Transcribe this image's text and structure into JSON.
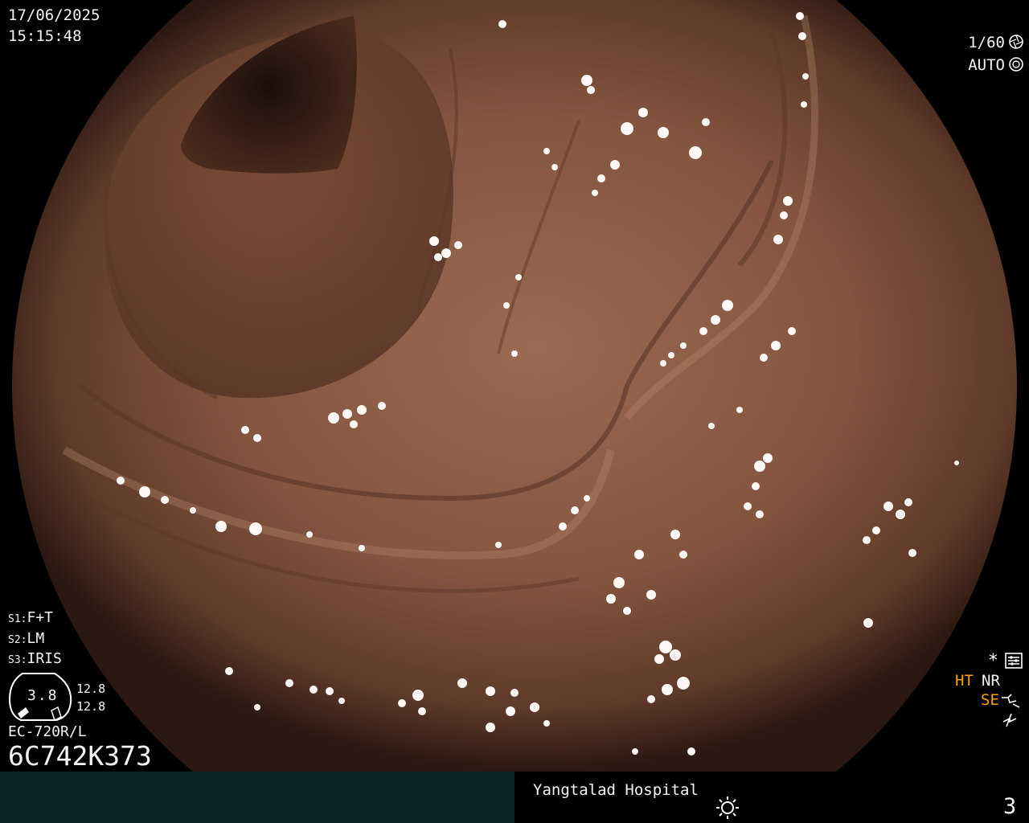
{
  "header": {
    "date": "17/06/2025",
    "time": "15:15:48",
    "shutter": "1/60",
    "exposure_mode": "AUTO"
  },
  "settings": {
    "s1_label": "S1:",
    "s1_value": "F+T",
    "s2_label": "S2:",
    "s2_value": "LM",
    "s3_label": "S3:",
    "s3_value": "IRIS"
  },
  "scope": {
    "gauge_value": "3.8",
    "zoom_top": "12.8",
    "zoom_bottom": "12.8",
    "model": "EC-720R/L",
    "serial": "6C742K373"
  },
  "status_indicators": {
    "star": "*",
    "ht": "HT",
    "nr": "NR",
    "se": "SE"
  },
  "footer": {
    "hospital": "Yangtalad Hospital",
    "page": "3"
  },
  "icons": [
    "aperture-icon",
    "auto-exposure-icon",
    "settings-menu-icon",
    "structure-enhance-icon",
    "flash-icon",
    "sun-icon"
  ],
  "colors": {
    "background": "#000000",
    "footer_left": "#0d2424",
    "highlight_orange": "#ffa200",
    "tissue": "#8a5a43"
  }
}
